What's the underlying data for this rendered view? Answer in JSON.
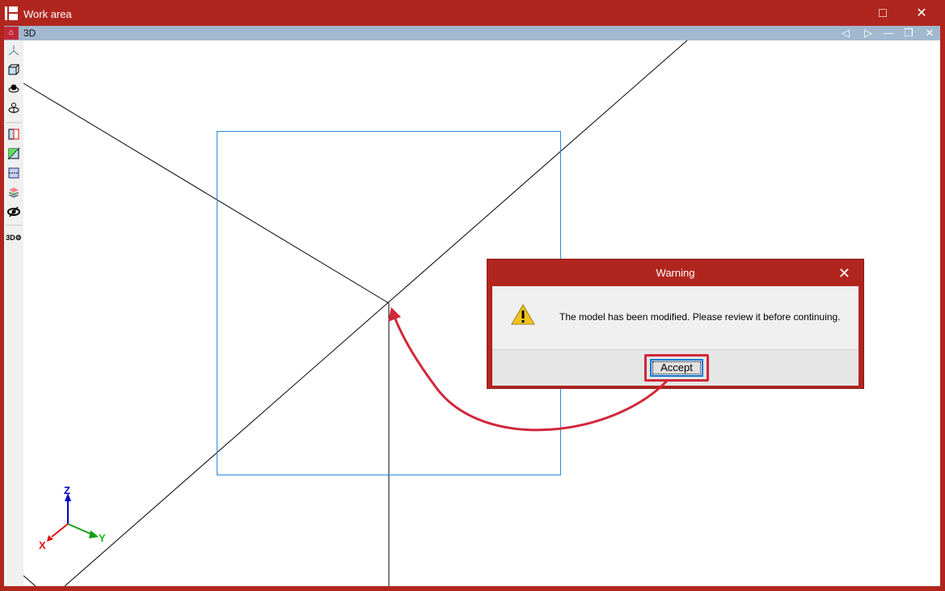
{
  "window": {
    "title": "Work area",
    "maximize_icon": "□",
    "close_icon": "✕"
  },
  "view": {
    "title": "3D",
    "prev_icon": "◁",
    "next_icon": "▷",
    "minimize_icon": "—",
    "restore_icon": "❐",
    "close_icon": "✕"
  },
  "axes": {
    "x": "X",
    "y": "Y",
    "z": "Z"
  },
  "dialog": {
    "title": "Warning",
    "close_icon": "✕",
    "message": "The model has been modified. Please review it before continuing.",
    "accept_label": "Accept"
  },
  "colors": {
    "chrome": "#b0261e",
    "viewbar": "#a1b8cf",
    "highlight": "#d0273a",
    "focus": "#0a78d7"
  }
}
